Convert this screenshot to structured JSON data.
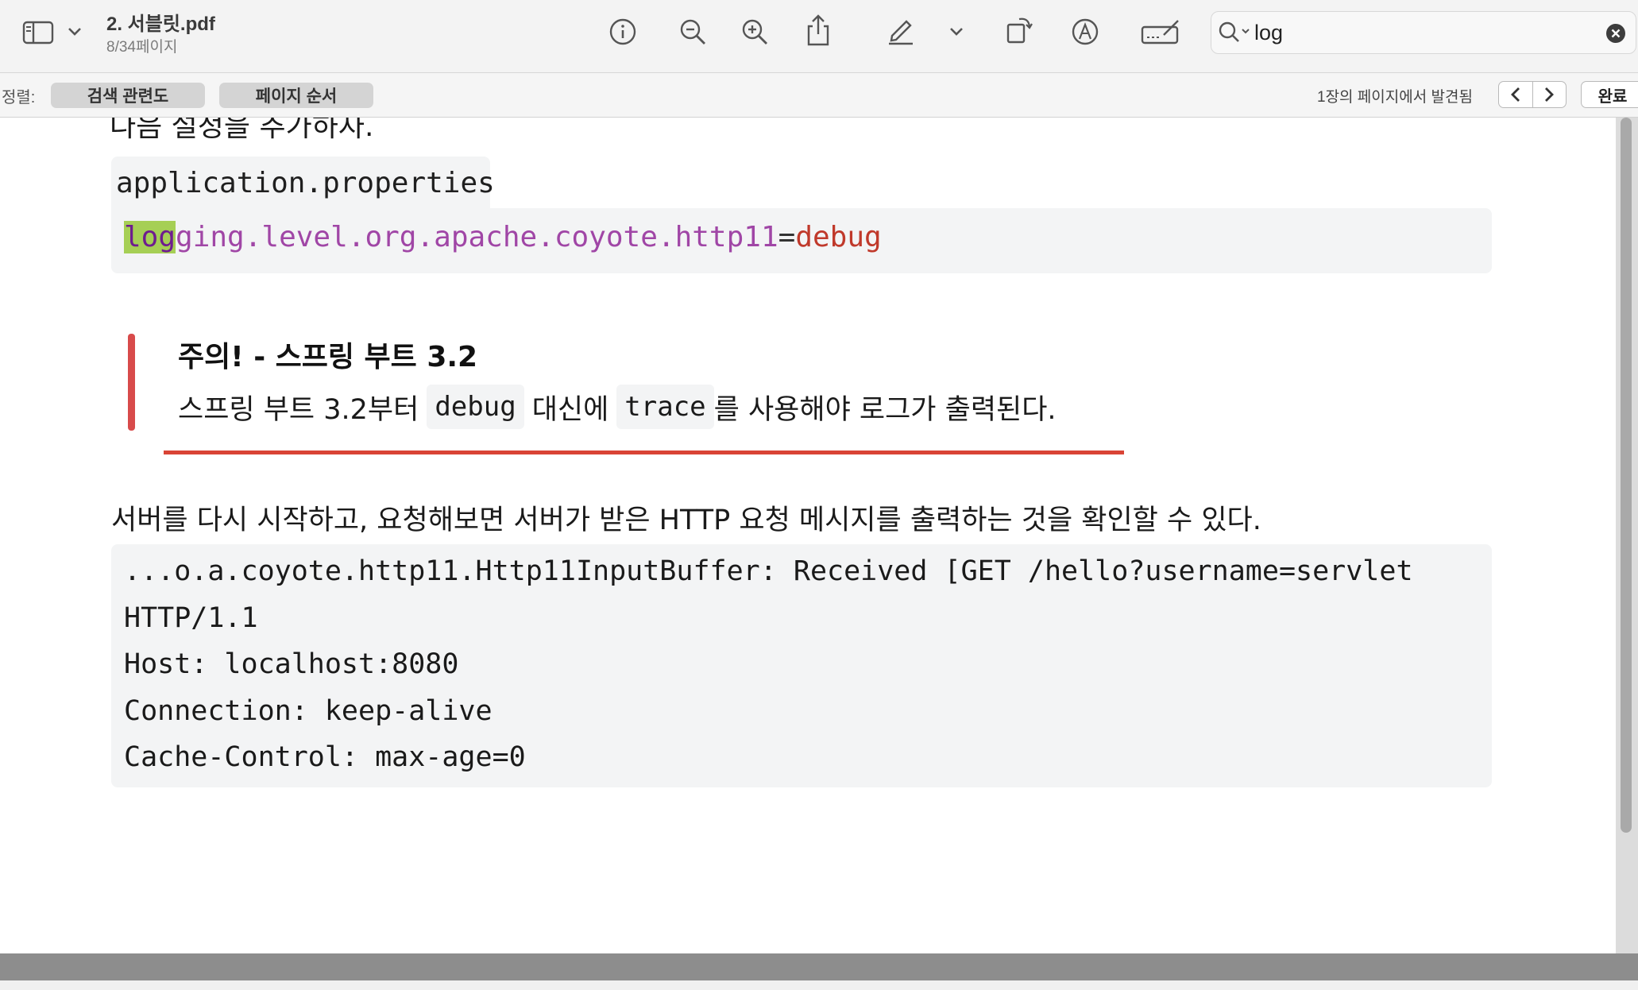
{
  "toolbar": {
    "doc_title": "2. 서블릿.pdf",
    "doc_page": "8/34페이지",
    "search": {
      "value": "log"
    }
  },
  "sortbar": {
    "label": "정렬:",
    "pill_relevance": "검색 관련도",
    "pill_page_order": "페이지 순서",
    "results": "1장의 페이지에서 발견됨",
    "done": "완료"
  },
  "content": {
    "cut_text": "다음 설정을 추가하자.",
    "filename": "application.properties",
    "code_line": {
      "highlight": "log",
      "key": "ging.level.org.apache.coyote.http11",
      "eq": "=",
      "value": "debug"
    },
    "warning": {
      "title": "주의! - 스프링 부트 3.2",
      "pre": "스프링 부트 3.2부터",
      "code1": "debug",
      "mid": "대신에",
      "code2": "trace",
      "post": "를 사용해야 로그가 출력된다."
    },
    "paragraph": "서버를 다시 시작하고, 요청해보면 서버가 받은 HTTP 요청 메시지를 출력하는 것을 확인할 수 있다.",
    "log_lines": [
      "...o.a.coyote.http11.Http11InputBuffer: Received [GET /hello?username=servlet",
      "HTTP/1.1",
      "Host: localhost:8080",
      "Connection: keep-alive",
      "Cache-Control: max-age=0"
    ]
  },
  "icons": [
    "sidebar-icon",
    "chevron-down-icon",
    "info-icon",
    "zoom-out-icon",
    "zoom-in-icon",
    "share-icon",
    "highlight-pen-icon",
    "rotate-icon",
    "markup-icon",
    "sign-icon",
    "search-icon",
    "clear-icon",
    "chevron-left-icon",
    "chevron-right-icon"
  ],
  "colors": {
    "highlight": "#a6cf55",
    "warning_bar": "#d84b4b",
    "code_key": "#a046a6",
    "code_value": "#c0392b"
  }
}
